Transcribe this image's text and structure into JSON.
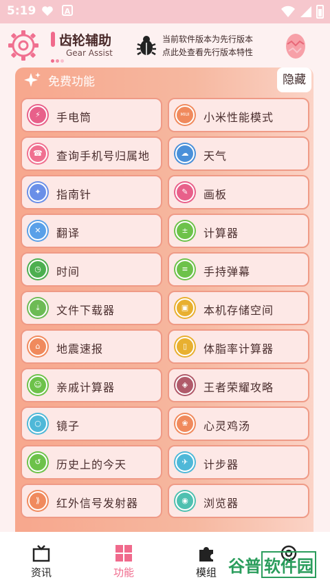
{
  "status_bar": {
    "time": "5:19"
  },
  "header": {
    "app_title": "齿轮辅助",
    "app_subtitle": "Gear Assist",
    "notice_line1": "当前软件版本为先行版本",
    "notice_line2": "点此处查看先行版本特性"
  },
  "panel": {
    "title": "免费功能",
    "hide_label": "隐藏",
    "items": [
      {
        "label": "手电筒",
        "color": "#e8608a",
        "icon": "flashlight-icon",
        "glyph": "⚡"
      },
      {
        "label": "小米性能模式",
        "color": "#f08a5d",
        "icon": "miui-icon",
        "glyph": "MIUI"
      },
      {
        "label": "查询手机号归属地",
        "color": "#f07090",
        "icon": "phone-location-icon",
        "glyph": "☎"
      },
      {
        "label": "天气",
        "color": "#4a90d9",
        "icon": "weather-icon",
        "glyph": "☁"
      },
      {
        "label": "指南针",
        "color": "#6a8fe8",
        "icon": "compass-icon",
        "glyph": "✦"
      },
      {
        "label": "画板",
        "color": "#e8608a",
        "icon": "palette-icon",
        "glyph": "✎"
      },
      {
        "label": "翻译",
        "color": "#5aa0e8",
        "icon": "translate-icon",
        "glyph": "✕"
      },
      {
        "label": "计算器",
        "color": "#6dc24a",
        "icon": "calculator-icon",
        "glyph": "±"
      },
      {
        "label": "时间",
        "color": "#4caf50",
        "icon": "clock-icon",
        "glyph": "◷"
      },
      {
        "label": "手持弹幕",
        "color": "#6dc24a",
        "icon": "danmaku-icon",
        "glyph": "≡"
      },
      {
        "label": "文件下载器",
        "color": "#6dbb55",
        "icon": "download-icon",
        "glyph": "⤓"
      },
      {
        "label": "本机存储空间",
        "color": "#e8b030",
        "icon": "storage-icon",
        "glyph": "▣"
      },
      {
        "label": "地震速报",
        "color": "#f08a5d",
        "icon": "earthquake-icon",
        "glyph": "⌂"
      },
      {
        "label": "体脂率计算器",
        "color": "#e8b030",
        "icon": "bodyfat-icon",
        "glyph": "▯"
      },
      {
        "label": "亲戚计算器",
        "color": "#6dc24a",
        "icon": "relatives-icon",
        "glyph": "☺"
      },
      {
        "label": "王者荣耀攻略",
        "color": "#b05a6a",
        "icon": "game-guide-icon",
        "glyph": "◈"
      },
      {
        "label": "镜子",
        "color": "#4fb8d8",
        "icon": "mirror-icon",
        "glyph": "○"
      },
      {
        "label": "心灵鸡汤",
        "color": "#f08a5d",
        "icon": "soup-icon",
        "glyph": "❀"
      },
      {
        "label": "历史上的今天",
        "color": "#6dc24a",
        "icon": "history-icon",
        "glyph": "↺"
      },
      {
        "label": "计步器",
        "color": "#4fb8d8",
        "icon": "pedometer-icon",
        "glyph": "✈"
      },
      {
        "label": "红外信号发射器",
        "color": "#f08a5d",
        "icon": "infrared-icon",
        "glyph": "⟫"
      },
      {
        "label": "浏览器",
        "color": "#4fc0b0",
        "icon": "browser-icon",
        "glyph": "◉"
      }
    ]
  },
  "bottom_nav": [
    {
      "label": "资讯",
      "icon": "news-icon"
    },
    {
      "label": "功能",
      "icon": "features-icon"
    },
    {
      "label": "模组",
      "icon": "modules-icon"
    },
    {
      "label": "",
      "icon": "profile-icon"
    }
  ],
  "watermark": {
    "text1": "谷普",
    "text2": "软件园"
  },
  "colors": {
    "accent": "#f06a8c",
    "panel": "#f7a78d",
    "item_border": "#ef9a86"
  }
}
